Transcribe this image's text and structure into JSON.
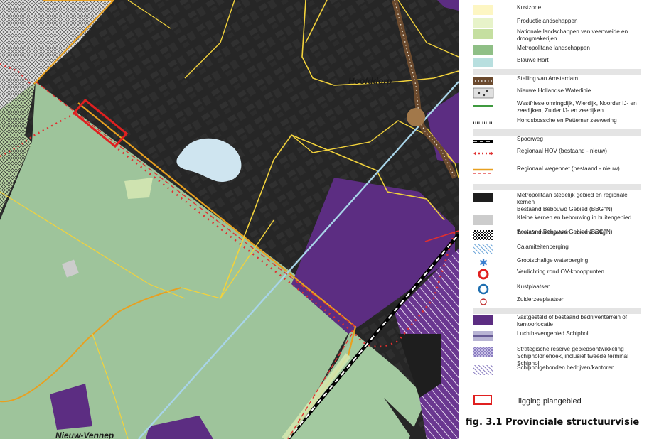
{
  "places": {
    "hoofddorp": "Hoofddorp",
    "nieuw_vennep": "Nieuw-Vennep"
  },
  "legend": [
    {
      "id": "kustzone",
      "label": "Kustzone",
      "swatch": "fill",
      "color": "#fdf6c3"
    },
    {
      "id": "productie",
      "label": "Productielandschappen",
      "swatch": "fill",
      "color": "#e7f3c9"
    },
    {
      "id": "nationale",
      "label": "Nationale landschappen van veenweide en droogmakerijen",
      "swatch": "fill",
      "color": "#c5dfa0"
    },
    {
      "id": "metropolitaan-land",
      "label": "Metropolitane landschappen",
      "swatch": "fill",
      "color": "#8fbf86"
    },
    {
      "id": "blauwe-hart",
      "label": "Blauwe Hart",
      "swatch": "fill",
      "color": "#b8dfdf"
    },
    {
      "id": "stelling",
      "label": "Stelling van Amsterdam",
      "swatch": "stelling",
      "color": "#6b4a2e"
    },
    {
      "id": "nhw",
      "label": "Nieuwe Hollandse Waterlinie",
      "swatch": "nhw",
      "color": "#999999"
    },
    {
      "id": "westfriese",
      "label": "Westfriese omringdijk, Wierdijk, Noorder IJ- en zeedijken, Zuider IJ- en zeedijken",
      "swatch": "greenline",
      "color": "#3f9a3f"
    },
    {
      "id": "hondsbossche",
      "label": "Hondsbossche en Pettemer zeewering",
      "swatch": "hatchline",
      "color": "#333333"
    },
    {
      "id": "spoorweg",
      "label": "Spoorweg",
      "swatch": "rail",
      "color": "#000000"
    },
    {
      "id": "hov",
      "label": "Regionaal HOV (bestaand - nieuw)",
      "swatch": "hov",
      "color": "#e03030"
    },
    {
      "id": "wegennet",
      "label": "Regionaal wegennet (bestaand - nieuw)",
      "swatch": "road",
      "color": "#e8a020"
    },
    {
      "id": "metro-stedelijk",
      "label": "Metropolitaan stedelijk gebied en regionale kernen",
      "label2": "Bestaand Bebouwd Gebied (BBG^N)",
      "swatch": "fill",
      "color": "#1e1e1e"
    },
    {
      "id": "kleine-kernen",
      "label": "Kleine kernen en bebouwing in buitengebied",
      "label2": "Bestaand Bebouwd Gebied (BBG^N)",
      "swatch": "fill",
      "color": "#cccccc"
    },
    {
      "id": "transformatie",
      "label": "Transformatiegebied - meervoudig",
      "swatch": "checker",
      "color": "#111111"
    },
    {
      "id": "calamiteit",
      "label": "Calamiteitenberging",
      "swatch": "bluehatch",
      "color": "#4a90d0"
    },
    {
      "id": "waterberging",
      "label": "Grootschalige waterberging",
      "swatch": "star",
      "color": "#3a7fd0"
    },
    {
      "id": "verdichting",
      "label": "Verdichting rond OV-knooppunten",
      "swatch": "redring",
      "color": "#e02020"
    },
    {
      "id": "kustplaatsen",
      "label": "Kustplaatsen",
      "swatch": "bluering",
      "color": "#1f6fb0"
    },
    {
      "id": "zuiderzee",
      "label": "Zuiderzeeplaatsen",
      "swatch": "smallring",
      "color": "#c03030"
    },
    {
      "id": "bedrijven",
      "label": "Vastgesteld of bestaand bedrijventerrein of kantoorlocatie",
      "swatch": "fill",
      "color": "#5c2d82"
    },
    {
      "id": "luchthaven",
      "label": "Luchthavengebied Schiphol",
      "swatch": "luchthaven",
      "color": "#b8b4d4"
    },
    {
      "id": "strategisch",
      "label": "Strategische reserve gebiedsontwikkeling Schipholdriehoek, inclusief tweede terminal Schiphol",
      "swatch": "purplecheck",
      "color": "#8a7cc0"
    },
    {
      "id": "schipholbedrijven",
      "label": "Schipholgebonden bedrijven/kantoren",
      "swatch": "purplehatch",
      "color": "#7a6cb8"
    }
  ],
  "plan": {
    "label": "ligging plangebied",
    "color": "#e02020"
  },
  "caption": "fig. 3.1 Provinciale structuurvisie"
}
